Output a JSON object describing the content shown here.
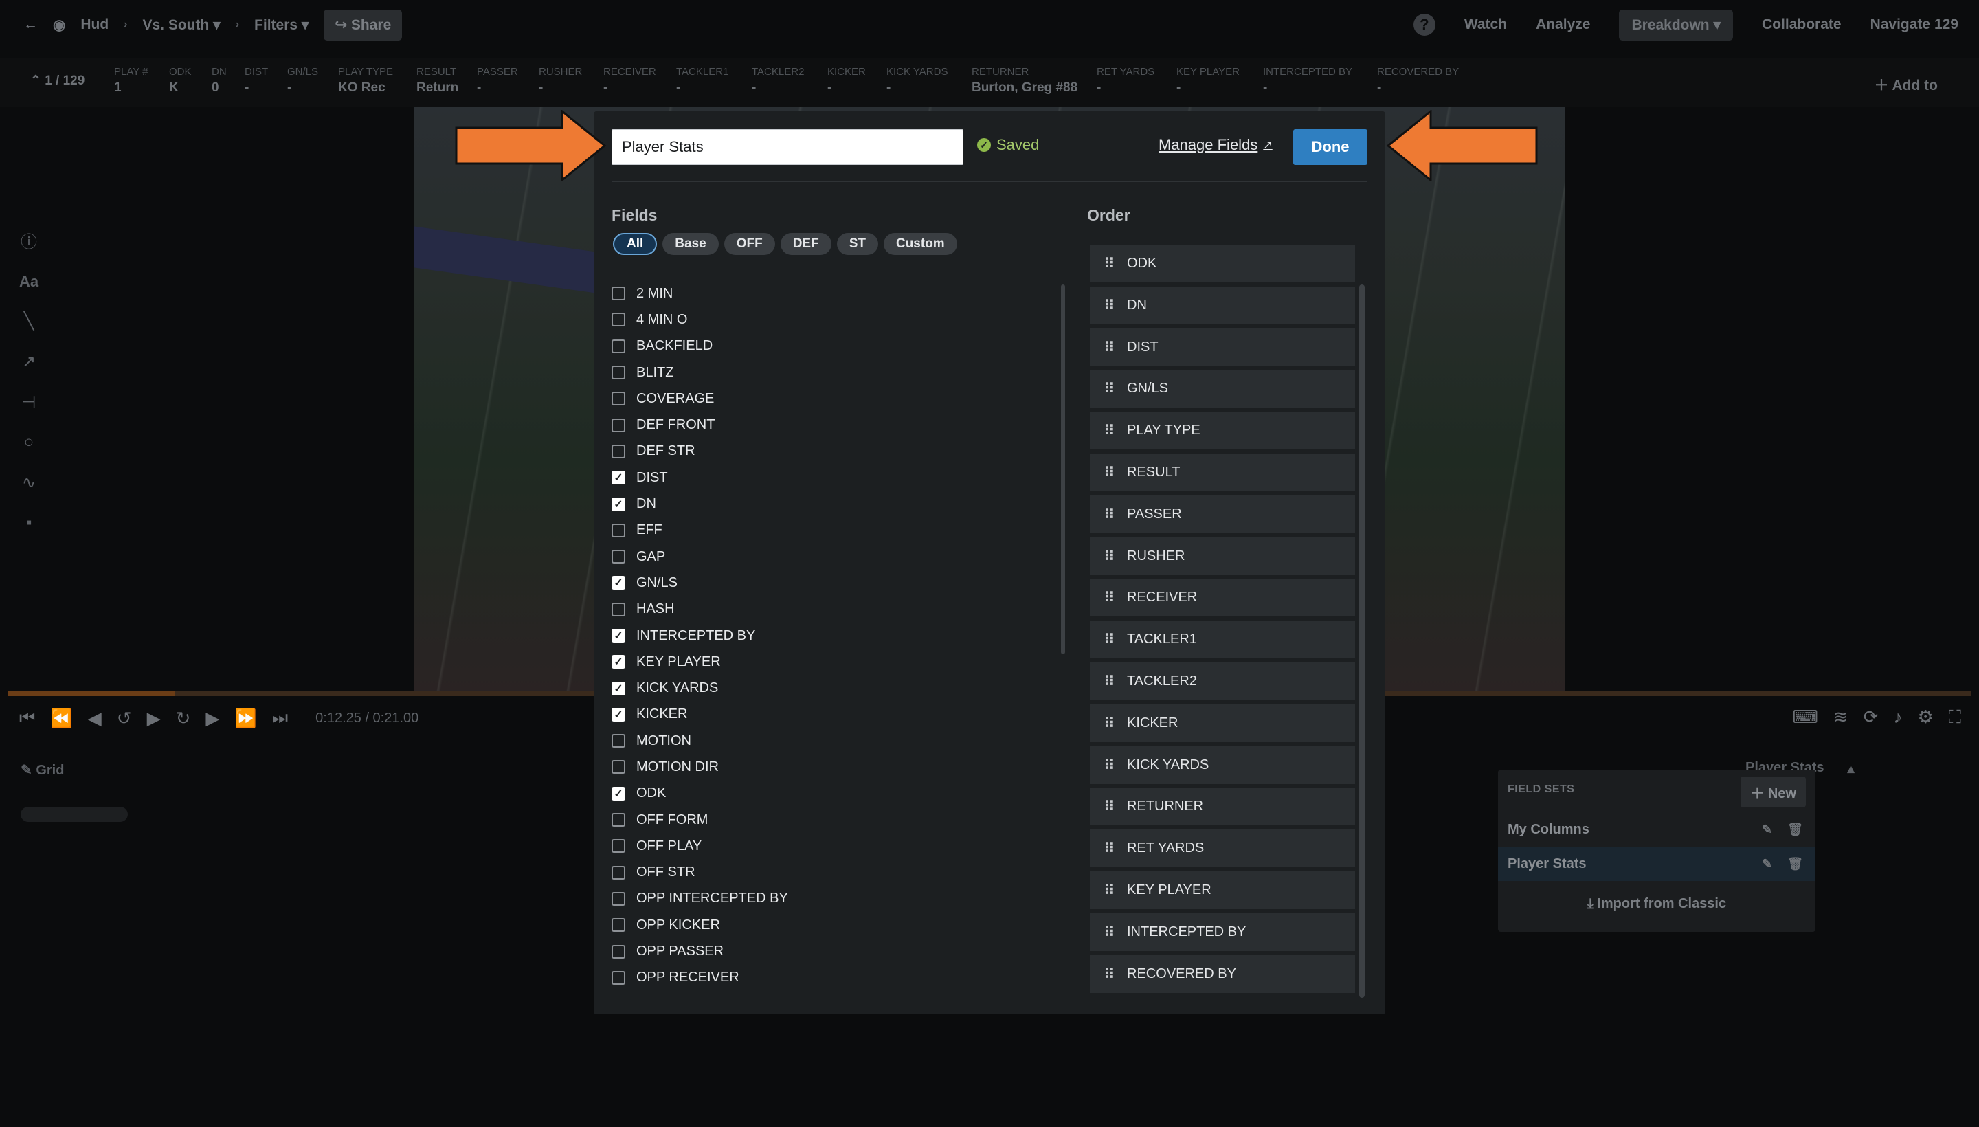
{
  "topbar": {
    "hud": "Hud",
    "opponent": "Vs. South",
    "filters": "Filters",
    "share": "Share",
    "help": "?",
    "nav": [
      "Watch",
      "Analyze",
      "Breakdown",
      "Collaborate",
      "Navigate"
    ],
    "navigate_count": "129"
  },
  "playbar": {
    "counter": "1 / 129",
    "columns": [
      {
        "h": "PLAY #",
        "v": "1"
      },
      {
        "h": "ODK",
        "v": "K"
      },
      {
        "h": "DN",
        "v": "0"
      },
      {
        "h": "DIST",
        "v": "-"
      },
      {
        "h": "GN/LS",
        "v": "-"
      },
      {
        "h": "PLAY TYPE",
        "v": "KO Rec"
      },
      {
        "h": "RESULT",
        "v": "Return"
      },
      {
        "h": "PASSER",
        "v": "-"
      },
      {
        "h": "RUSHER",
        "v": "-"
      },
      {
        "h": "RECEIVER",
        "v": "-"
      },
      {
        "h": "TACKLER1",
        "v": "-"
      },
      {
        "h": "TACKLER2",
        "v": "-"
      },
      {
        "h": "KICKER",
        "v": "-"
      },
      {
        "h": "KICK YARDS",
        "v": "-"
      },
      {
        "h": "RETURNER",
        "v": "Burton, Greg #88"
      },
      {
        "h": "RET YARDS",
        "v": "-"
      },
      {
        "h": "KEY PLAYER",
        "v": "-"
      },
      {
        "h": "INTERCEPTED BY",
        "v": "-"
      },
      {
        "h": "RECOVERED BY",
        "v": "-"
      }
    ],
    "add_to": "Add to"
  },
  "player": {
    "time": "0:12.25 / 0:21.00",
    "progress": 0.085
  },
  "grid_label": "Grid",
  "field_sets_panel": {
    "current": "Player Stats",
    "header": "FIELD SETS",
    "new_label": "New",
    "items": [
      "My Columns",
      "Player Stats"
    ],
    "import_label": "Import from Classic"
  },
  "modal": {
    "title_value": "Player Stats",
    "saved": "Saved",
    "manage_fields": "Manage Fields",
    "done": "Done",
    "fields_heading": "Fields",
    "order_heading": "Order",
    "filters": [
      "All",
      "Base",
      "OFF",
      "DEF",
      "ST",
      "Custom"
    ],
    "active_filter": "All",
    "fields": [
      {
        "label": "2 MIN",
        "checked": false
      },
      {
        "label": "4 MIN O",
        "checked": false
      },
      {
        "label": "BACKFIELD",
        "checked": false
      },
      {
        "label": "BLITZ",
        "checked": false
      },
      {
        "label": "COVERAGE",
        "checked": false
      },
      {
        "label": "DEF FRONT",
        "checked": false
      },
      {
        "label": "DEF STR",
        "checked": false
      },
      {
        "label": "DIST",
        "checked": true
      },
      {
        "label": "DN",
        "checked": true
      },
      {
        "label": "EFF",
        "checked": false
      },
      {
        "label": "GAP",
        "checked": false
      },
      {
        "label": "GN/LS",
        "checked": true
      },
      {
        "label": "HASH",
        "checked": false
      },
      {
        "label": "INTERCEPTED BY",
        "checked": true
      },
      {
        "label": "KEY PLAYER",
        "checked": true
      },
      {
        "label": "KICK YARDS",
        "checked": true
      },
      {
        "label": "KICKER",
        "checked": true
      },
      {
        "label": "MOTION",
        "checked": false
      },
      {
        "label": "MOTION DIR",
        "checked": false
      },
      {
        "label": "ODK",
        "checked": true
      },
      {
        "label": "OFF FORM",
        "checked": false
      },
      {
        "label": "OFF PLAY",
        "checked": false
      },
      {
        "label": "OFF STR",
        "checked": false
      },
      {
        "label": "OPP INTERCEPTED BY",
        "checked": false
      },
      {
        "label": "OPP KICKER",
        "checked": false
      },
      {
        "label": "OPP PASSER",
        "checked": false
      },
      {
        "label": "OPP RECEIVER",
        "checked": false
      }
    ],
    "order": [
      "ODK",
      "DN",
      "DIST",
      "GN/LS",
      "PLAY TYPE",
      "RESULT",
      "PASSER",
      "RUSHER",
      "RECEIVER",
      "TACKLER1",
      "TACKLER2",
      "KICKER",
      "KICK YARDS",
      "RETURNER",
      "RET YARDS",
      "KEY PLAYER",
      "INTERCEPTED BY",
      "RECOVERED BY"
    ]
  },
  "colors": {
    "accent": "#2f7fc1",
    "saved": "#8db84a",
    "arrow": "#ee7a33"
  }
}
